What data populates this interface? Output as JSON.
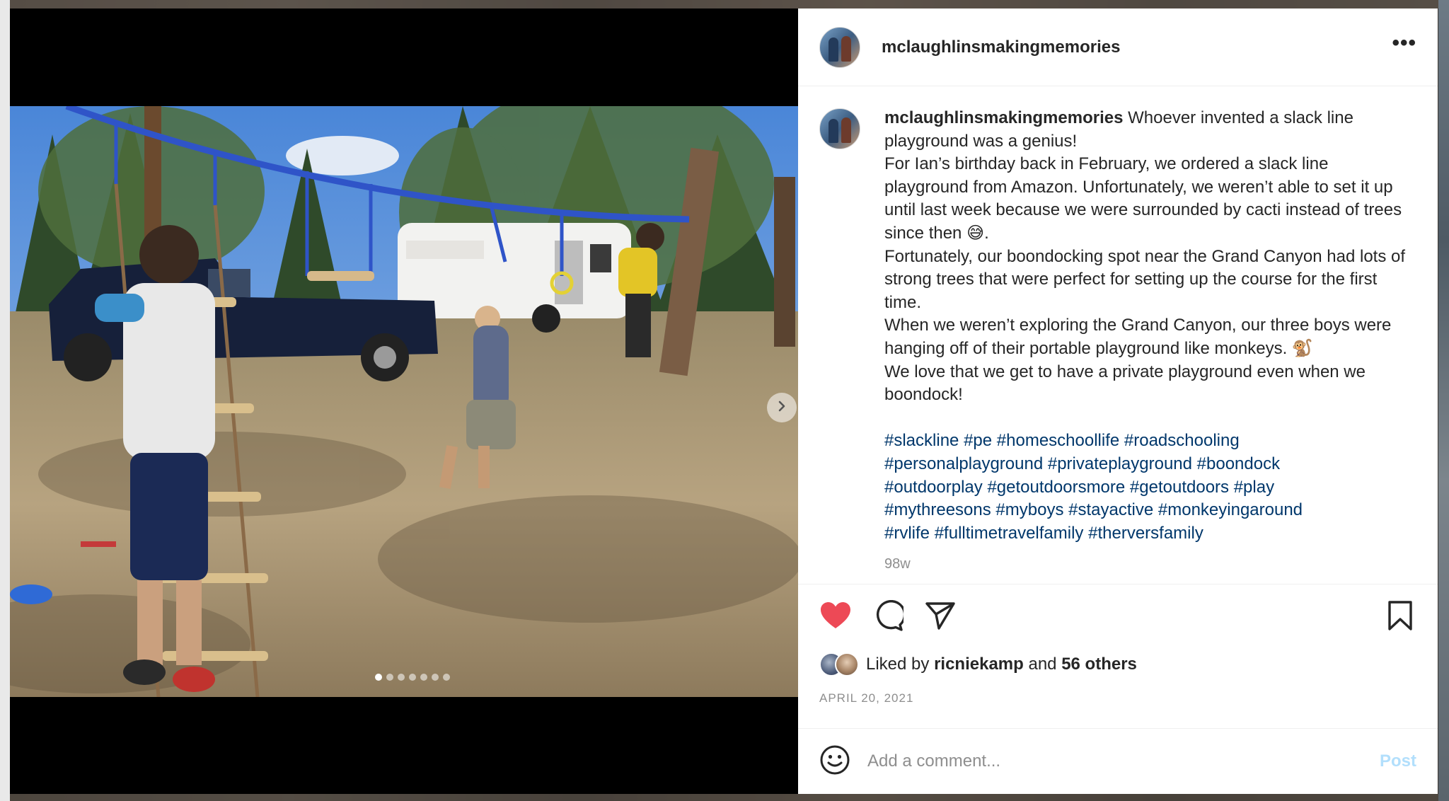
{
  "post": {
    "username": "mclaughlinsmakingmemories",
    "caption_lines": [
      " Whoever invented a slack line playground was a genius!",
      "For Ian’s birthday back in February, we ordered a slack line playground from Amazon. Unfortunately, we weren’t able to set it up until last week because we were surrounded by cacti instead of trees since then 😅.",
      "Fortunately, our boondocking spot near the Grand Canyon had lots of strong trees that were perfect for setting up the course for the first time.",
      "When we weren’t exploring the Grand Canyon, our three boys were hanging off of their portable playground like monkeys. 🐒",
      "We love that we get to have a private playground even when we boondock!"
    ],
    "hashtags": [
      "#slackline",
      "#pe",
      "#homeschoollife",
      "#roadschooling",
      "#personalplayground",
      "#privateplayground",
      "#boondock",
      "#outdoorplay",
      "#getoutdoorsmore",
      "#getoutdoors",
      "#play",
      "#mythreesons",
      "#myboys",
      "#stayactive",
      "#monkeyingaround",
      "#rvlife",
      "#fulltimetravelfamily",
      "#therversfamily"
    ],
    "age": "98w",
    "liked_by_prefix": "Liked by",
    "liked_by_user": "ricniekamp",
    "liked_by_and": "and",
    "liked_by_others": "56 others",
    "date": "APRIL 20, 2021",
    "more_label": "•••"
  },
  "media": {
    "slide_count": 7,
    "active_slide": 1
  },
  "comment": {
    "placeholder": "Add a comment...",
    "post_label": "Post"
  },
  "icons": {
    "like": "heart-filled-icon",
    "comment": "speech-bubble-icon",
    "share": "paper-plane-icon",
    "save": "bookmark-icon",
    "emoji": "smiley-icon",
    "next": "chevron-right-icon"
  },
  "colors": {
    "like_red": "#ed4956",
    "hashtag_blue": "#00376b",
    "post_button_disabled": "#b2dffc",
    "muted_text": "#8e8e8e"
  }
}
